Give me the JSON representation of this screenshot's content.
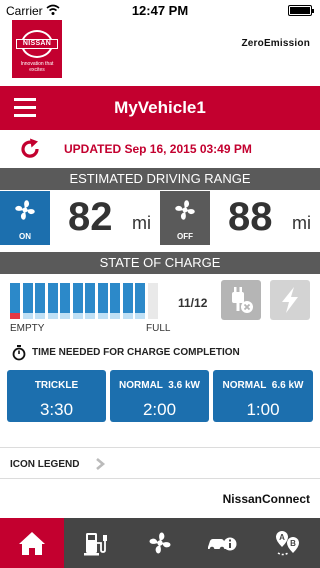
{
  "status_bar": {
    "carrier": "Carrier",
    "time": "12:47 PM"
  },
  "brand": {
    "logo_text": "NISSAN",
    "tagline": "Innovation that excites",
    "zero_emission": "ZeroEmission"
  },
  "header": {
    "title": "MyVehicle1"
  },
  "updated": {
    "text": "UPDATED Sep 16, 2015 03:49 PM"
  },
  "range": {
    "heading": "ESTIMATED DRIVING RANGE",
    "climate_on": {
      "state": "ON",
      "value": "82",
      "unit": "mi"
    },
    "climate_off": {
      "state": "OFF",
      "value": "88",
      "unit": "mi"
    }
  },
  "charge": {
    "heading": "STATE OF CHARGE",
    "segments_filled": 11,
    "segments_total": 12,
    "count_text": "11/12",
    "empty_label": "EMPTY",
    "full_label": "FULL"
  },
  "charge_time": {
    "label": "TIME NEEDED FOR CHARGE COMPLETION",
    "modes": [
      {
        "name": "TRICKLE",
        "duration": "3:30"
      },
      {
        "name": "NORMAL  3.6 kW",
        "duration": "2:00"
      },
      {
        "name": "NORMAL  6.6 kW",
        "duration": "1:00"
      }
    ]
  },
  "legend": {
    "label": "ICON LEGEND"
  },
  "footer": {
    "brand": "NissanConnect"
  },
  "tabs": [
    {
      "icon": "home-icon",
      "active": true
    },
    {
      "icon": "charging-station-icon",
      "active": false
    },
    {
      "icon": "fan-icon",
      "active": false
    },
    {
      "icon": "vehicle-info-icon",
      "active": false
    },
    {
      "icon": "route-ab-icon",
      "active": false
    }
  ],
  "colors": {
    "brand_red": "#c3002f",
    "accent_blue": "#1c6fae",
    "header_gray": "#5a5a5a",
    "tabbar_gray": "#454545"
  }
}
